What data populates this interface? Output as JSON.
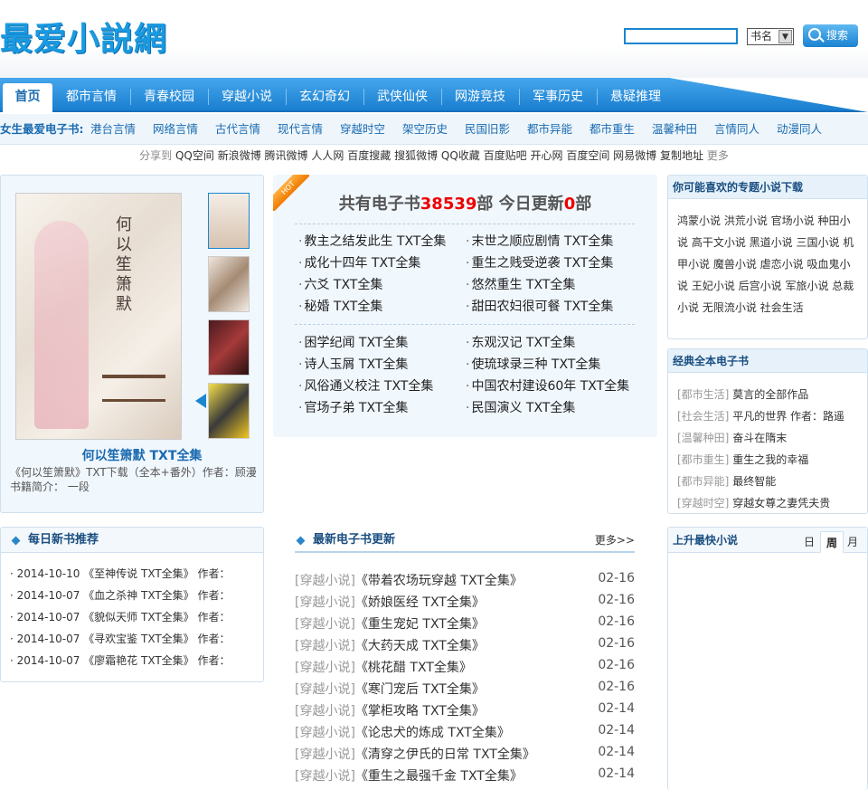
{
  "header": {
    "logo": "最爱小説網",
    "search_placeholder": "",
    "select_value": "书名",
    "search_button": "搜索"
  },
  "nav": {
    "items": [
      "首页",
      "都市言情",
      "青春校园",
      "穿越小说",
      "玄幻奇幻",
      "武侠仙侠",
      "网游竞技",
      "军事历史",
      "悬疑推理"
    ]
  },
  "subnav": {
    "label": "女生最爱电子书:",
    "links": [
      "港台言情",
      "网络言情",
      "古代言情",
      "现代言情",
      "穿越时空",
      "架空历史",
      "民国旧影",
      "都市异能",
      "都市重生",
      "温馨种田",
      "言情同人",
      "动漫同人"
    ]
  },
  "share": {
    "label": "分享到",
    "links": [
      "QQ空间",
      "新浪微博",
      "腾讯微博",
      "人人网",
      "百度搜藏",
      "搜狐微博",
      "QQ收藏",
      "百度贴吧",
      "开心网",
      "百度空间",
      "网易微博",
      "复制地址"
    ],
    "more": "更多"
  },
  "featured": {
    "cover_title": "何以笙箫默",
    "name": "何以笙箫默 TXT全集",
    "desc_line1": "《何以笙箫默》TXT下载（全本+番外）作者：顾漫",
    "desc_line2": "书籍简介： 一段"
  },
  "stats": {
    "prefix": "共有电子书",
    "total": "38539",
    "mid": "部 今日更新",
    "today": "0",
    "suffix": "部",
    "hot": "HOT"
  },
  "books_a": [
    "教主之结发此生 TXT全集",
    "末世之顺应剧情 TXT全集",
    "成化十四年 TXT全集",
    "重生之贱受逆袭 TXT全集",
    "六爻 TXT全集",
    "悠然重生 TXT全集",
    "秘婚 TXT全集",
    "甜田农妇很可餐 TXT全集"
  ],
  "books_b": [
    "困学纪闻 TXT全集",
    "东观汉记 TXT全集",
    "诗人玉屑 TXT全集",
    "使琉球录三种 TXT全集",
    "风俗通义校注 TXT全集",
    "中国农村建设60年 TXT全集",
    "官场子弟 TXT全集",
    "民国演义 TXT全集"
  ],
  "topics": {
    "title": "你可能喜欢的专题小说下载",
    "text": "鸿蒙小说 洪荒小说 官场小说 种田小说 高干文小说 黑道小说 三国小说 机甲小说 魔兽小说 虐恋小说 吸血鬼小说 王妃小说 后宫小说 军旅小说 总裁小说 无限流小说 社会生活"
  },
  "classic": {
    "title": "经典全本电子书",
    "rows": [
      [
        "[都市生活]",
        "莫言的全部作品"
      ],
      [
        "[社会生活]",
        "平凡的世界 作者：路遥"
      ],
      [
        "[温馨种田]",
        "奋斗在隋末"
      ],
      [
        "[都市重生]",
        "重生之我的幸福"
      ],
      [
        "[都市异能]",
        "最终智能"
      ],
      [
        "[穿越时空]",
        "穿越女尊之妻凭夫贵"
      ]
    ]
  },
  "daily": {
    "title": "每日新书推荐",
    "rows": [
      "· 2014-10-10 《至神传说 TXT全集》 作者：",
      "· 2014-10-07 《血之杀神 TXT全集》 作者：",
      "· 2014-10-07 《貌似天师 TXT全集》 作者：",
      "· 2014-10-07 《寻欢宝鉴 TXT全集》 作者：",
      "· 2014-10-07 《廖霜艳花 TXT全集》 作者："
    ]
  },
  "latest": {
    "title": "最新电子书更新",
    "more": "更多>>",
    "rows": [
      [
        "[穿越小说]",
        "《带着农场玩穿越 TXT全集》",
        "02-16"
      ],
      [
        "[穿越小说]",
        "《娇娘医经 TXT全集》",
        "02-16"
      ],
      [
        "[穿越小说]",
        "《重生宠妃 TXT全集》",
        "02-16"
      ],
      [
        "[穿越小说]",
        "《大药天成 TXT全集》",
        "02-16"
      ],
      [
        "[穿越小说]",
        "《桃花醋 TXT全集》",
        "02-16"
      ],
      [
        "[穿越小说]",
        "《寒门宠后 TXT全集》",
        "02-16"
      ],
      [
        "[穿越小说]",
        "《掌柜攻略 TXT全集》",
        "02-14"
      ],
      [
        "[穿越小说]",
        "《论忠犬的炼成 TXT全集》",
        "02-14"
      ],
      [
        "[穿越小说]",
        "《清穿之伊氏的日常 TXT全集》",
        "02-14"
      ],
      [
        "[穿越小说]",
        "《重生之最强千金 TXT全集》",
        "02-14"
      ]
    ]
  },
  "rising": {
    "title": "上升最快小说",
    "tabs": [
      "日",
      "周",
      "月"
    ]
  },
  "colors": {
    "accent": "#1a86d0",
    "red": "#e00000"
  }
}
